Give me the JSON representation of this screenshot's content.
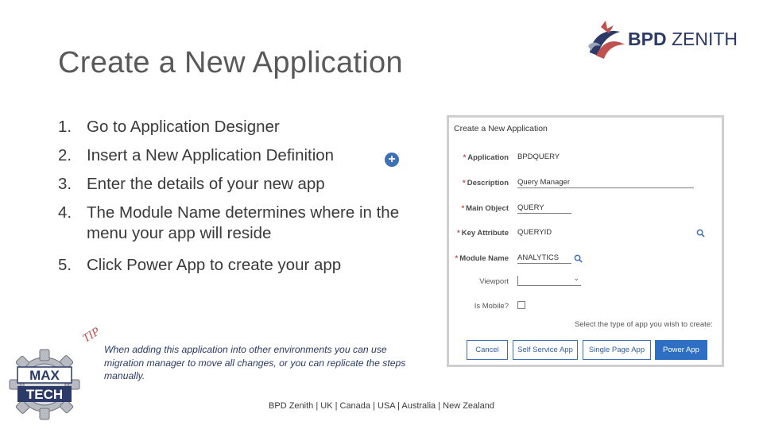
{
  "slide": {
    "title": "Create a New Application",
    "footer": "BPD Zenith | UK | Canada | USA | Australia | New Zealand"
  },
  "logo": {
    "brand_bold": "BPD",
    "brand_light": "ZENITH"
  },
  "steps": [
    {
      "num": "1.",
      "text": "Go to Application Designer"
    },
    {
      "num": "2.",
      "text": "Insert a New Application Definition"
    },
    {
      "num": "3.",
      "text": "Enter the details of your new app"
    },
    {
      "num": "4.",
      "text": "The Module Name determines where in the menu your app will reside"
    },
    {
      "num": "5.",
      "text": "Click Power App to create your app"
    }
  ],
  "tip": {
    "label": "TIP",
    "text": "When adding this application into other environments you can use migration manager to move all changes, or you can replicate the steps manually."
  },
  "dialog": {
    "title": "Create a New Application",
    "fields": {
      "application": {
        "label": "Application",
        "value": "BPDQUERY"
      },
      "description": {
        "label": "Description",
        "value": "Query Manager"
      },
      "main_object": {
        "label": "Main Object",
        "value": "QUERY"
      },
      "key_attribute": {
        "label": "Key Attribute",
        "value": "QUERYID"
      },
      "module_name": {
        "label": "Module Name",
        "value": "ANALYTICS"
      },
      "viewport": {
        "label": "Viewport",
        "value": ""
      },
      "is_mobile": {
        "label": "Is Mobile?"
      }
    },
    "hint": "Select the type of app you wish to create:",
    "buttons": {
      "cancel": "Cancel",
      "self_service": "Self Service App",
      "single_page": "Single Page App",
      "power": "Power App"
    }
  },
  "gear_logo": {
    "line1": "MAX",
    "line2": "TECH"
  },
  "colors": {
    "accent_blue": "#2e6fc4",
    "logo_navy": "#2b3a67",
    "tip_red": "#c0504d"
  }
}
